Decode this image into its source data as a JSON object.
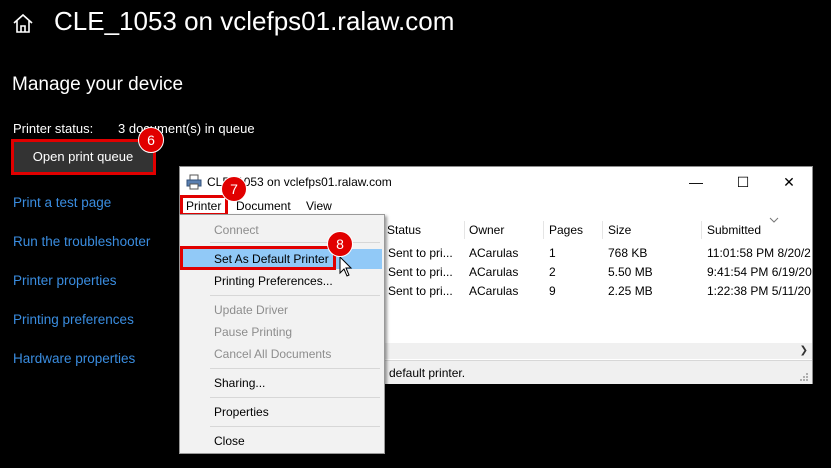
{
  "page": {
    "title": "CLE_1053 on vclefps01.ralaw.com",
    "section_title": "Manage your device",
    "status_label": "Printer status:",
    "status_value": "3 document(s) in queue",
    "open_queue_button": "Open print queue",
    "links": [
      "Print a test page",
      "Run the troubleshooter",
      "Printer properties",
      "Printing preferences",
      "Hardware properties"
    ]
  },
  "badges": {
    "b6": "6",
    "b7": "7",
    "b8": "8"
  },
  "queue_window": {
    "title": "CLE_1053 on vclefps01.ralaw.com",
    "menu": {
      "printer": "Printer",
      "document": "Document",
      "view": "View"
    },
    "columns": [
      "Status",
      "Owner",
      "Pages",
      "Size",
      "Submitted"
    ],
    "rows": [
      {
        "status": "Sent to pri...",
        "owner": "ACarulas",
        "pages": "1",
        "size": "768 KB",
        "submitted": "11:01:58 PM  8/20/2"
      },
      {
        "status": "Sent to pri...",
        "owner": "ACarulas",
        "pages": "2",
        "size": "5.50 MB",
        "submitted": "9:41:54 PM  6/19/20"
      },
      {
        "status": "Sent to pri...",
        "owner": "ACarulas",
        "pages": "9",
        "size": "2.25 MB",
        "submitted": "1:22:38 PM  5/11/20"
      }
    ],
    "status_bar": "default printer."
  },
  "printer_menu": {
    "connect": "Connect",
    "set_default": "Set As Default Printer",
    "printing_preferences": "Printing Preferences...",
    "update_driver": "Update Driver",
    "pause_printing": "Pause Printing",
    "cancel_all": "Cancel All Documents",
    "sharing": "Sharing...",
    "properties": "Properties",
    "close": "Close"
  },
  "colors": {
    "accent_link": "#3a8de0",
    "highlight_red": "#e10000",
    "menu_hover": "#91c9f7"
  }
}
